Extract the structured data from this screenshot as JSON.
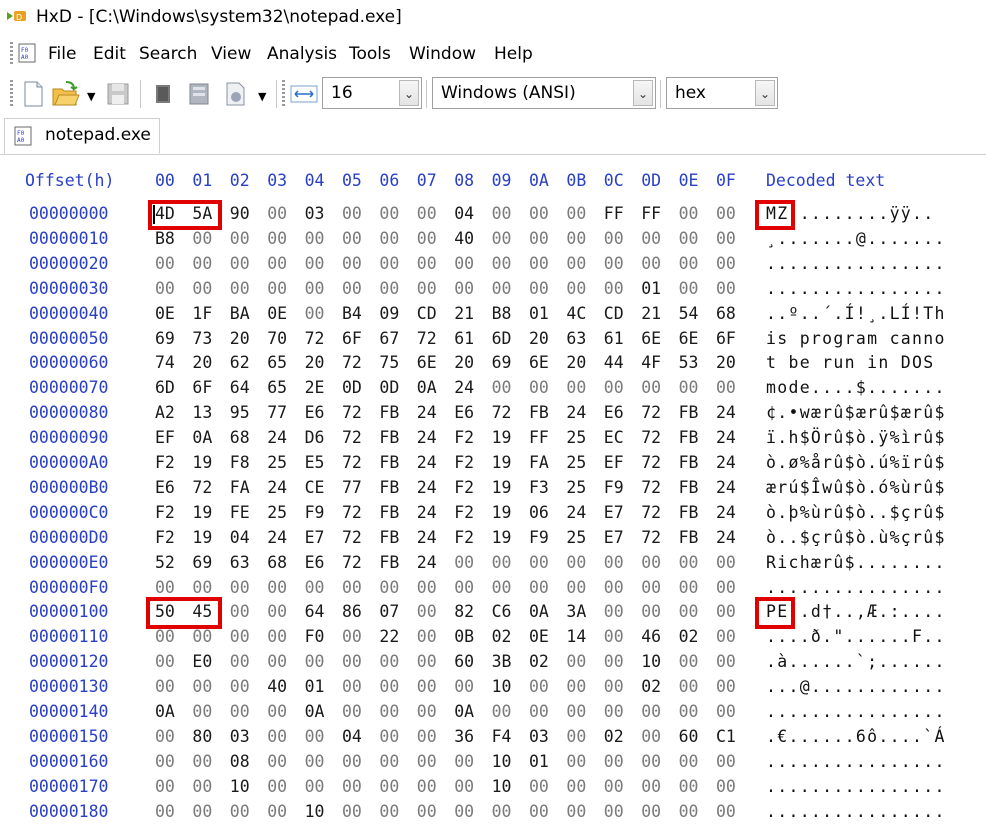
{
  "window": {
    "title": "HxD - [C:\\Windows\\system32\\notepad.exe]"
  },
  "menu": [
    "File",
    "Edit",
    "Search",
    "View",
    "Analysis",
    "Tools",
    "Window",
    "Help"
  ],
  "toolbar": {
    "bytes_per_row": "16",
    "charset": "Windows (ANSI)",
    "offset_base": "hex",
    "icons": [
      "new-file-icon",
      "open-file-icon",
      "save-icon",
      "close-icon",
      "properties-icon",
      "export-icon",
      "column-width-icon"
    ]
  },
  "tab": {
    "label": "notepad.exe"
  },
  "header": {
    "offset_label": "Offset(h)",
    "columns": [
      "00",
      "01",
      "02",
      "03",
      "04",
      "05",
      "06",
      "07",
      "08",
      "09",
      "0A",
      "0B",
      "0C",
      "0D",
      "0E",
      "0F"
    ],
    "decoded_label": "Decoded text"
  },
  "rows": [
    {
      "offset": "00000000",
      "bytes": [
        "4D",
        "5A",
        "90",
        "00",
        "03",
        "00",
        "00",
        "00",
        "04",
        "00",
        "00",
        "00",
        "FF",
        "FF",
        "00",
        "00"
      ],
      "text": "MZ.........ÿÿ.."
    },
    {
      "offset": "00000010",
      "bytes": [
        "B8",
        "00",
        "00",
        "00",
        "00",
        "00",
        "00",
        "00",
        "40",
        "00",
        "00",
        "00",
        "00",
        "00",
        "00",
        "00"
      ],
      "text": "¸.......@......."
    },
    {
      "offset": "00000020",
      "bytes": [
        "00",
        "00",
        "00",
        "00",
        "00",
        "00",
        "00",
        "00",
        "00",
        "00",
        "00",
        "00",
        "00",
        "00",
        "00",
        "00"
      ],
      "text": "................"
    },
    {
      "offset": "00000030",
      "bytes": [
        "00",
        "00",
        "00",
        "00",
        "00",
        "00",
        "00",
        "00",
        "00",
        "00",
        "00",
        "00",
        "00",
        "01",
        "00",
        "00"
      ],
      "text": "................"
    },
    {
      "offset": "00000040",
      "bytes": [
        "0E",
        "1F",
        "BA",
        "0E",
        "00",
        "B4",
        "09",
        "CD",
        "21",
        "B8",
        "01",
        "4C",
        "CD",
        "21",
        "54",
        "68"
      ],
      "text": "..º..´.Í!¸.LÍ!Th"
    },
    {
      "offset": "00000050",
      "bytes": [
        "69",
        "73",
        "20",
        "70",
        "72",
        "6F",
        "67",
        "72",
        "61",
        "6D",
        "20",
        "63",
        "61",
        "6E",
        "6E",
        "6F"
      ],
      "text": "is program canno"
    },
    {
      "offset": "00000060",
      "bytes": [
        "74",
        "20",
        "62",
        "65",
        "20",
        "72",
        "75",
        "6E",
        "20",
        "69",
        "6E",
        "20",
        "44",
        "4F",
        "53",
        "20"
      ],
      "text": "t be run in DOS "
    },
    {
      "offset": "00000070",
      "bytes": [
        "6D",
        "6F",
        "64",
        "65",
        "2E",
        "0D",
        "0D",
        "0A",
        "24",
        "00",
        "00",
        "00",
        "00",
        "00",
        "00",
        "00"
      ],
      "text": "mode....$......."
    },
    {
      "offset": "00000080",
      "bytes": [
        "A2",
        "13",
        "95",
        "77",
        "E6",
        "72",
        "FB",
        "24",
        "E6",
        "72",
        "FB",
        "24",
        "E6",
        "72",
        "FB",
        "24"
      ],
      "text": "¢.•wærû$ærû$ærû$"
    },
    {
      "offset": "00000090",
      "bytes": [
        "EF",
        "0A",
        "68",
        "24",
        "D6",
        "72",
        "FB",
        "24",
        "F2",
        "19",
        "FF",
        "25",
        "EC",
        "72",
        "FB",
        "24"
      ],
      "text": "ï.h$Örû$ò.ÿ%ìrû$"
    },
    {
      "offset": "000000A0",
      "bytes": [
        "F2",
        "19",
        "F8",
        "25",
        "E5",
        "72",
        "FB",
        "24",
        "F2",
        "19",
        "FA",
        "25",
        "EF",
        "72",
        "FB",
        "24"
      ],
      "text": "ò.ø%årû$ò.ú%ïrû$"
    },
    {
      "offset": "000000B0",
      "bytes": [
        "E6",
        "72",
        "FA",
        "24",
        "CE",
        "77",
        "FB",
        "24",
        "F2",
        "19",
        "F3",
        "25",
        "F9",
        "72",
        "FB",
        "24"
      ],
      "text": "ærú$Îwû$ò.ó%ùrû$"
    },
    {
      "offset": "000000C0",
      "bytes": [
        "F2",
        "19",
        "FE",
        "25",
        "F9",
        "72",
        "FB",
        "24",
        "F2",
        "19",
        "06",
        "24",
        "E7",
        "72",
        "FB",
        "24"
      ],
      "text": "ò.þ%ùrû$ò..$çrû$"
    },
    {
      "offset": "000000D0",
      "bytes": [
        "F2",
        "19",
        "04",
        "24",
        "E7",
        "72",
        "FB",
        "24",
        "F2",
        "19",
        "F9",
        "25",
        "E7",
        "72",
        "FB",
        "24"
      ],
      "text": "ò..$çrû$ò.ù%çrû$"
    },
    {
      "offset": "000000E0",
      "bytes": [
        "52",
        "69",
        "63",
        "68",
        "E6",
        "72",
        "FB",
        "24",
        "00",
        "00",
        "00",
        "00",
        "00",
        "00",
        "00",
        "00"
      ],
      "text": "Richærû$........"
    },
    {
      "offset": "000000F0",
      "bytes": [
        "00",
        "00",
        "00",
        "00",
        "00",
        "00",
        "00",
        "00",
        "00",
        "00",
        "00",
        "00",
        "00",
        "00",
        "00",
        "00"
      ],
      "text": "................"
    },
    {
      "offset": "00000100",
      "bytes": [
        "50",
        "45",
        "00",
        "00",
        "64",
        "86",
        "07",
        "00",
        "82",
        "C6",
        "0A",
        "3A",
        "00",
        "00",
        "00",
        "00"
      ],
      "text": "PE..d†..‚Æ.:...."
    },
    {
      "offset": "00000110",
      "bytes": [
        "00",
        "00",
        "00",
        "00",
        "F0",
        "00",
        "22",
        "00",
        "0B",
        "02",
        "0E",
        "14",
        "00",
        "46",
        "02",
        "00"
      ],
      "text": "....ð.\"......F.."
    },
    {
      "offset": "00000120",
      "bytes": [
        "00",
        "E0",
        "00",
        "00",
        "00",
        "00",
        "00",
        "00",
        "60",
        "3B",
        "02",
        "00",
        "00",
        "10",
        "00",
        "00"
      ],
      "text": ".à......`;......"
    },
    {
      "offset": "00000130",
      "bytes": [
        "00",
        "00",
        "00",
        "40",
        "01",
        "00",
        "00",
        "00",
        "00",
        "10",
        "00",
        "00",
        "00",
        "02",
        "00",
        "00"
      ],
      "text": "...@............"
    },
    {
      "offset": "00000140",
      "bytes": [
        "0A",
        "00",
        "00",
        "00",
        "0A",
        "00",
        "00",
        "00",
        "0A",
        "00",
        "00",
        "00",
        "00",
        "00",
        "00",
        "00"
      ],
      "text": "................"
    },
    {
      "offset": "00000150",
      "bytes": [
        "00",
        "80",
        "03",
        "00",
        "00",
        "04",
        "00",
        "00",
        "36",
        "F4",
        "03",
        "00",
        "02",
        "00",
        "60",
        "C1"
      ],
      "text": ".€......6ô....`Á"
    },
    {
      "offset": "00000160",
      "bytes": [
        "00",
        "00",
        "08",
        "00",
        "00",
        "00",
        "00",
        "00",
        "00",
        "10",
        "01",
        "00",
        "00",
        "00",
        "00",
        "00"
      ],
      "text": "................"
    },
    {
      "offset": "00000170",
      "bytes": [
        "00",
        "00",
        "10",
        "00",
        "00",
        "00",
        "00",
        "00",
        "00",
        "10",
        "00",
        "00",
        "00",
        "00",
        "00",
        "00"
      ],
      "text": "................"
    },
    {
      "offset": "00000180",
      "bytes": [
        "00",
        "00",
        "00",
        "00",
        "10",
        "00",
        "00",
        "00",
        "00",
        "00",
        "00",
        "00",
        "00",
        "00",
        "00",
        "00"
      ],
      "text": "................"
    }
  ],
  "colors": {
    "offset_blue": "#2a3fc8",
    "highlight_red": "#e00000"
  }
}
